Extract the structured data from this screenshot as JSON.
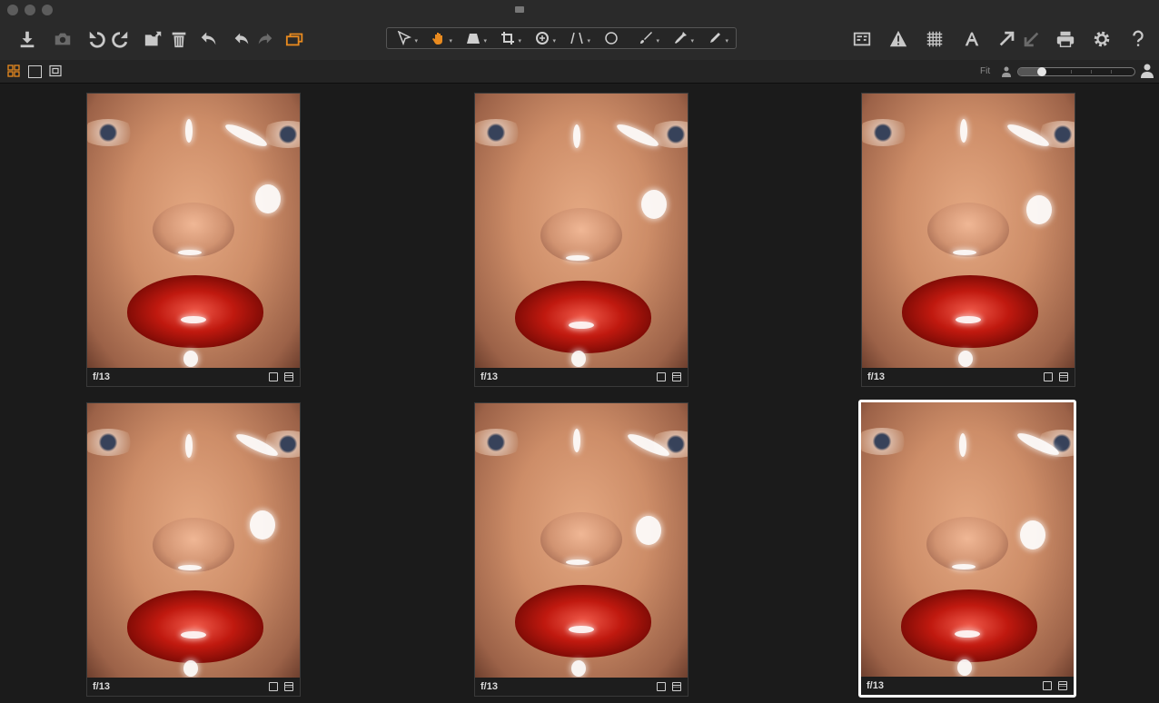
{
  "window": {
    "title_icon": "camera-mini-icon"
  },
  "toolbar": {
    "left_tools": [
      {
        "name": "import",
        "icon": "download-icon"
      },
      {
        "name": "capture",
        "icon": "camera-icon"
      },
      {
        "name": "rotate-left",
        "icon": "rotate-left-icon"
      },
      {
        "name": "rotate-right",
        "icon": "rotate-right-icon"
      },
      {
        "name": "move-to-folder",
        "icon": "folder-move-icon"
      },
      {
        "name": "delete",
        "icon": "trash-icon"
      },
      {
        "name": "reset",
        "icon": "reset-icon"
      },
      {
        "name": "undo",
        "icon": "undo-icon"
      },
      {
        "name": "redo",
        "icon": "redo-icon"
      },
      {
        "name": "stack",
        "icon": "stack-icon"
      }
    ],
    "cursor_tools": [
      {
        "name": "select",
        "icon": "arrow-cursor-icon"
      },
      {
        "name": "pan",
        "icon": "hand-icon"
      },
      {
        "name": "keystone",
        "icon": "keystone-icon"
      },
      {
        "name": "crop",
        "icon": "crop-icon"
      },
      {
        "name": "rotate",
        "icon": "rotate-tool-icon"
      },
      {
        "name": "perspective",
        "icon": "lines-icon"
      },
      {
        "name": "spot",
        "icon": "circle-icon"
      },
      {
        "name": "brush",
        "icon": "brush-icon"
      },
      {
        "name": "picker",
        "icon": "eyedropper-icon"
      },
      {
        "name": "annotate",
        "icon": "pen-icon"
      }
    ],
    "right_tools": [
      {
        "name": "compare",
        "icon": "compare-icon"
      },
      {
        "name": "exposure-warning",
        "icon": "warning-icon"
      },
      {
        "name": "grid",
        "icon": "grid-icon"
      },
      {
        "name": "text",
        "icon": "text-icon"
      },
      {
        "name": "copy-adjustments",
        "icon": "arrow-up-right-icon"
      },
      {
        "name": "apply-adjustments",
        "icon": "arrow-down-left-icon"
      },
      {
        "name": "print",
        "icon": "printer-icon"
      },
      {
        "name": "settings",
        "icon": "gear-icon"
      },
      {
        "name": "help",
        "icon": "help-icon"
      }
    ],
    "active_color": "#e88a1f"
  },
  "viewbar": {
    "view_modes": [
      "grid-view-icon",
      "single-view-icon",
      "multi-view-icon"
    ],
    "active_view": "grid-view-icon",
    "fit_label": "Fit",
    "zoom_fraction": 0.2
  },
  "thumbnails": [
    {
      "caption": "f/13",
      "selected": false
    },
    {
      "caption": "f/13",
      "selected": false
    },
    {
      "caption": "f/13",
      "selected": false
    },
    {
      "caption": "f/13",
      "selected": false
    },
    {
      "caption": "f/13",
      "selected": false
    },
    {
      "caption": "f/13",
      "selected": true
    }
  ]
}
